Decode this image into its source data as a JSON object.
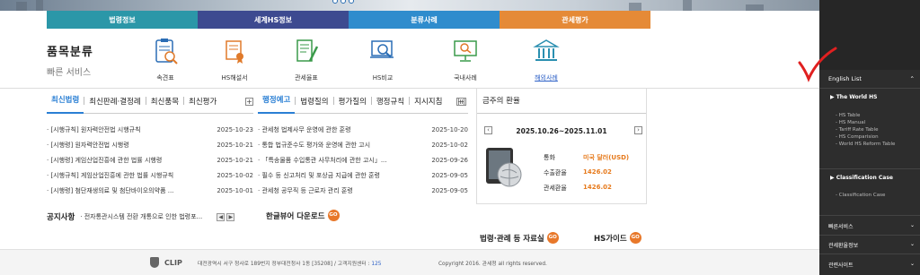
{
  "main_nav": [
    "법령정보",
    "세계HS정보",
    "분류사례",
    "관세평가"
  ],
  "brand": {
    "title": "품목분류",
    "subtitle": "빠른 서비스"
  },
  "quick_services": [
    {
      "label": "속견표",
      "icon": "clipboard-chart-icon"
    },
    {
      "label": "HS해설서",
      "icon": "certificate-scroll-icon"
    },
    {
      "label": "관세율표",
      "icon": "document-pen-icon"
    },
    {
      "label": "HS비교",
      "icon": "magnifier-compare-icon"
    },
    {
      "label": "국내사례",
      "icon": "monitor-search-icon"
    },
    {
      "label": "해외사례",
      "icon": "building-pillars-icon"
    }
  ],
  "panel1": {
    "tabs": [
      "최신법령",
      "최신판례·결정례",
      "최신품목",
      "최신평가"
    ],
    "rows": [
      {
        "title": "· [시행규칙] 원자력안전법 시행규칙",
        "date": "2025-10-23"
      },
      {
        "title": "· [시행령] 원자력안전법 시행령",
        "date": "2025-10-21"
      },
      {
        "title": "· [시행령] 게임산업진흥에 관한 법률 시행령",
        "date": "2025-10-21"
      },
      {
        "title": "· [시행규칙] 게임산업진흥에 관한 법률 시행규칙",
        "date": "2025-10-02"
      },
      {
        "title": "· [시행령] 첨단재생의료 및 첨단바이오의약품 ...",
        "date": "2025-10-01"
      }
    ]
  },
  "panel2": {
    "tabs": [
      "행정예고",
      "법령질의",
      "평가질의",
      "행정규칙",
      "지시지침"
    ],
    "rows": [
      {
        "title": "· 관세청 법제사무 운영에 관한 훈령",
        "date": "2025-10-20"
      },
      {
        "title": "· 통합 법규준수도 평가와 운영에 관한 고시",
        "date": "2025-10-02"
      },
      {
        "title": "· 「특송물품 수입통관 사무처리에 관한 고시」...",
        "date": "2025-09-26"
      },
      {
        "title": "· 필수 등 신고처리 및 포상금 지급에 관한 훈령",
        "date": "2025-09-05"
      },
      {
        "title": "· 관세청 공무직 등 근로자 관리 훈령",
        "date": "2025-09-05"
      }
    ]
  },
  "exchange": {
    "title": "금주의 환율",
    "period": "2025.10.26~2025.11.01",
    "currency_label": "통화",
    "currency_value": "미국 달러(USD)",
    "export_label": "수출환율",
    "export_value": "1426.02",
    "customs_label": "관세환율",
    "customs_value": "1426.02"
  },
  "notice": {
    "label": "공지사항",
    "text": "· 전자통관시스템 전환 개통으로 인한 법령포..."
  },
  "links": {
    "hangul_viewer": "한글뷰어 다운로드",
    "law_data": "법령·관례 등 자료실",
    "hs_guide": "HS가이드",
    "go": "GO"
  },
  "footer": {
    "logo": "CLIP",
    "address": "대전광역시 서구 청사로 189번지 정부대전청사 1동 [35208] / 고객지원센터 : ",
    "phone": "125",
    "copyright": "Copyright 2016. 관세청 all rights reserved."
  },
  "sidebar": {
    "english_list": "English List",
    "world_hs": "▶ The World HS",
    "world_hs_items": [
      "- HS Table",
      "- HS Manual",
      "- Tariff Rate Table",
      "- HS Comparision",
      "- World HS Reform Table"
    ],
    "classification": "▶ Classification Case",
    "classification_items": [
      "- Classification Case"
    ],
    "sections": [
      "빠른서비스",
      "관세환율정보",
      "관련사이트"
    ]
  }
}
